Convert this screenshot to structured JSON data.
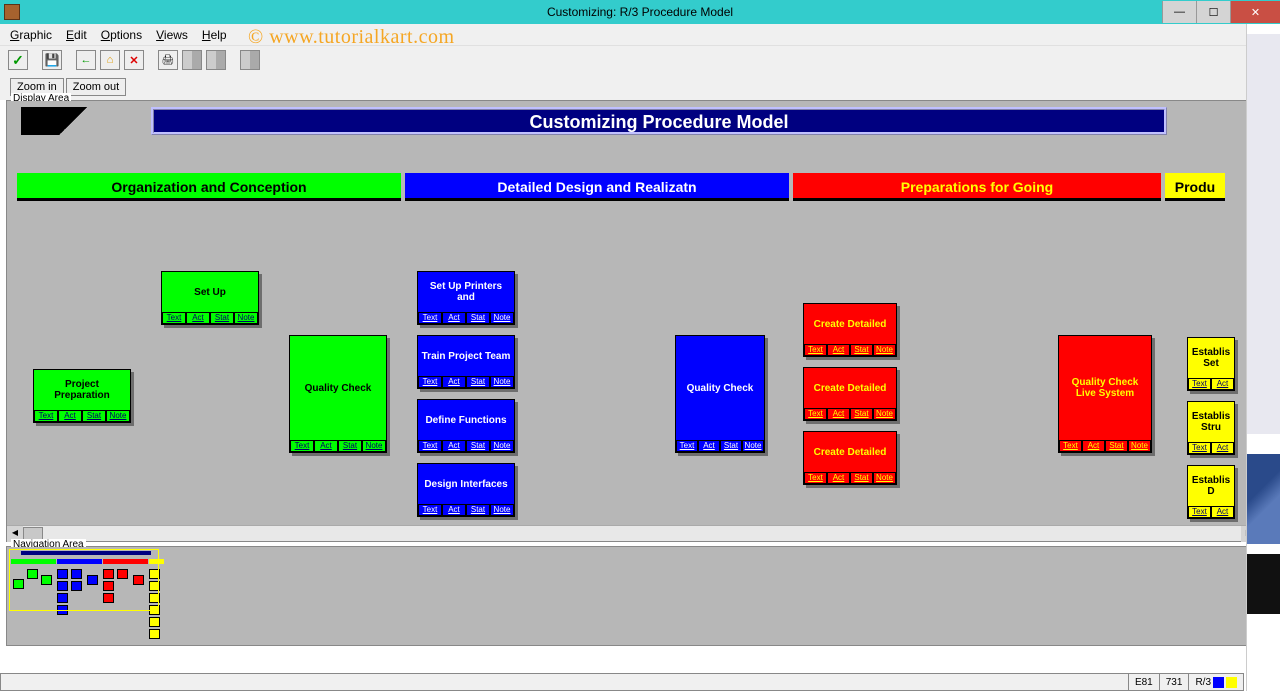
{
  "window": {
    "title": "Customizing: R/3 Procedure Model"
  },
  "watermark": "© www.tutorialkart.com",
  "menu": {
    "graphic": "Graphic",
    "edit": "Edit",
    "options": "Options",
    "views": "Views",
    "help": "Help"
  },
  "zoom": {
    "in": "Zoom in",
    "out": "Zoom out"
  },
  "labels": {
    "display_area": "Display Area",
    "nav_area": "Navigation Area"
  },
  "banner": "Customizing Procedure Model",
  "phases": {
    "p1": "Organization and Conception",
    "p2": "Detailed Design and Realizatn",
    "p3": "Preparations for Going",
    "p4": "Produ"
  },
  "tabs": {
    "t": "Text",
    "a": "Act",
    "s": "Stat",
    "n": "Note"
  },
  "nodes": {
    "proj_prep": "Project Preparation",
    "setup": "Set Up",
    "qc_green": "Quality Check",
    "setup_printers": "Set Up Printers and",
    "train_team": "Train Project Team",
    "define_func": "Define Functions",
    "design_if": "Design Interfaces",
    "qc_blue": "Quality Check",
    "create_det1": "Create Detailed",
    "create_det2": "Create Detailed",
    "create_det3": "Create Detailed",
    "qc_live": "Quality Check Live System",
    "establis1": "Establis Set",
    "establis2": "Establis Stru",
    "establis3": "Establis D"
  },
  "status": {
    "e": "E81",
    "n": "731",
    "sys": "R/3"
  }
}
